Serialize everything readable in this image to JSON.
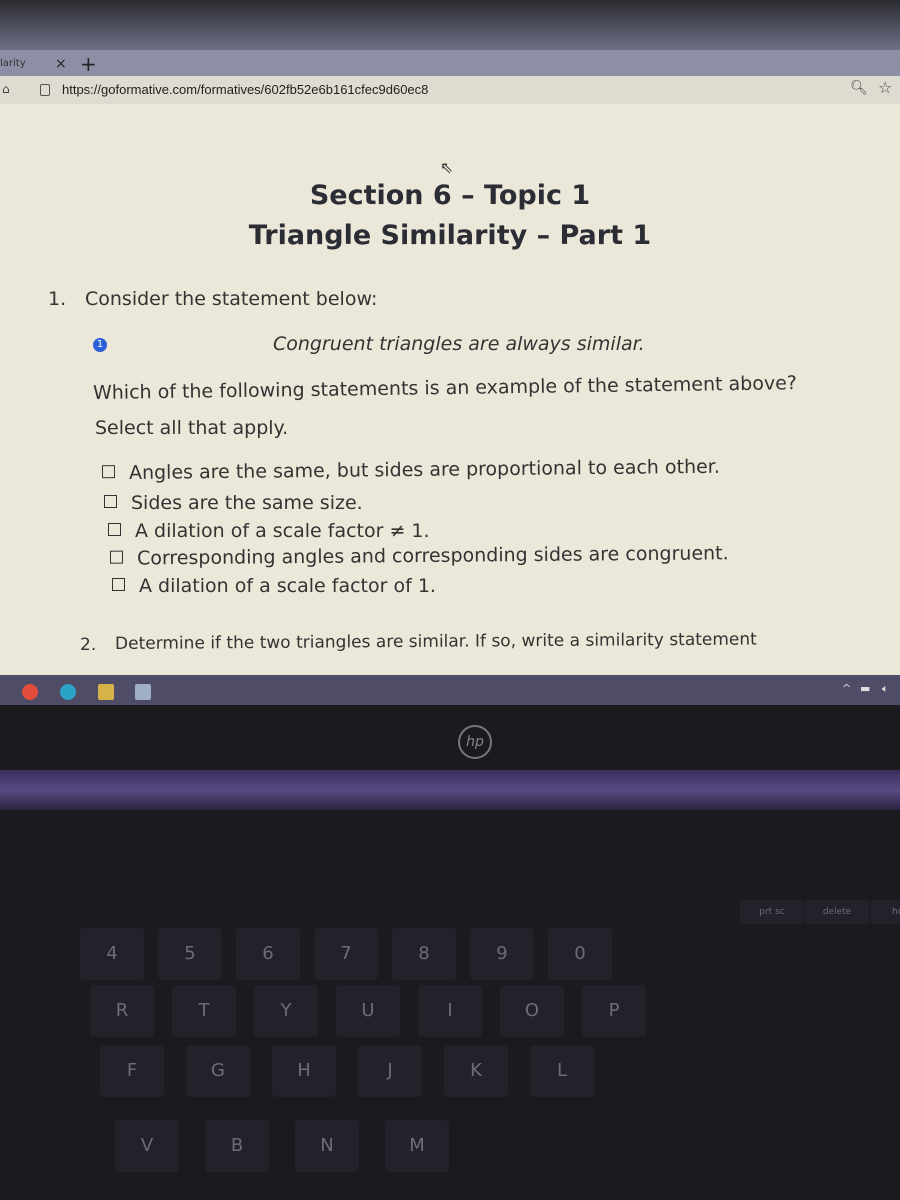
{
  "browser": {
    "tab_label": "larity",
    "close_symbol": "×",
    "new_tab_symbol": "+",
    "url": "https://goformative.com/formatives/602fb52e6b161cfec9d60ec8"
  },
  "document": {
    "title_line1": "Section 6 – Topic 1",
    "title_line2": "Triangle Similarity – Part 1",
    "q1_number": "1.",
    "q1_text": "Consider the statement below:",
    "q1_badge": "1",
    "q1_statement": "Congruent triangles are always similar.",
    "q1_prompt": "Which of the following statements is an example of the statement above?",
    "q1_instruction": "Select all that apply.",
    "options": [
      {
        "label": "Angles are the same, but sides are proportional to each other.",
        "checked": false
      },
      {
        "label": "Sides are the same size.",
        "checked": false
      },
      {
        "label": "A dilation of a scale factor ≠ 1.",
        "checked": false
      },
      {
        "label": "Corresponding angles and corresponding sides are congruent.",
        "checked": false
      },
      {
        "label": "A dilation of a scale factor of 1.",
        "checked": false
      }
    ],
    "q2_number": "2.",
    "q2_text": "Determine if the two triangles are similar. If so, write a similarity statement"
  },
  "taskbar": {
    "tray_up": "^"
  },
  "laptop": {
    "brand": "hp",
    "fkeys": [
      "prt sc",
      "delete",
      "hom"
    ],
    "number_row": [
      "4",
      "5",
      "6",
      "7",
      "8",
      "9",
      "0"
    ],
    "letter_row1": [
      "R",
      "T",
      "Y",
      "U",
      "I",
      "O",
      "P"
    ],
    "letter_row2": [
      "F",
      "G",
      "H",
      "J",
      "K",
      "L"
    ],
    "letter_row3": [
      "V",
      "B",
      "N",
      "M"
    ]
  },
  "colors": {
    "accent": "#2d5fd8",
    "taskbar": "#4e4c66",
    "page": "#ebe8d9"
  }
}
